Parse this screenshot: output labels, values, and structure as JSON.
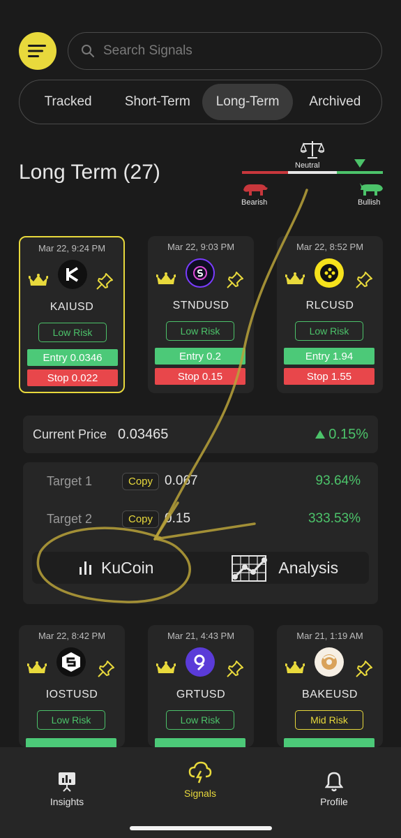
{
  "search": {
    "placeholder": "Search Signals"
  },
  "tabs": [
    {
      "label": "Tracked",
      "active": false
    },
    {
      "label": "Short-Term",
      "active": false
    },
    {
      "label": "Long-Term",
      "active": true
    },
    {
      "label": "Archived",
      "active": false
    }
  ],
  "page_title": "Long Term (27)",
  "sentiment": {
    "neutral_label": "Neutral",
    "bearish_label": "Bearish",
    "bullish_label": "Bullish"
  },
  "cards": [
    {
      "date": "Mar 22, 9:24 PM",
      "symbol": "KAIUSD",
      "risk": "Low Risk",
      "entry": "Entry 0.0346",
      "stop": "Stop 0.022",
      "logo": "kai-logo"
    },
    {
      "date": "Mar 22, 9:03 PM",
      "symbol": "STNDUSD",
      "risk": "Low Risk",
      "entry": "Entry 0.2",
      "stop": "Stop 0.15",
      "logo": "stnd-logo"
    },
    {
      "date": "Mar 22, 8:52 PM",
      "symbol": "RLCUSD",
      "risk": "Low Risk",
      "entry": "Entry 1.94",
      "stop": "Stop 1.55",
      "logo": "rlc-logo"
    },
    {
      "date": "Mar 22, 8:42 PM",
      "symbol": "IOSTUSD",
      "risk": "Low Risk",
      "logo": "iost-logo"
    },
    {
      "date": "Mar 21, 4:43 PM",
      "symbol": "GRTUSD",
      "risk": "Low Risk",
      "logo": "grt-logo"
    },
    {
      "date": "Mar 21, 1:19 AM",
      "symbol": "BAKEUSD",
      "risk": "Mid Risk",
      "logo": "bake-logo"
    }
  ],
  "details": {
    "current_price_label": "Current Price",
    "current_price": "0.03465",
    "change": "0.15%",
    "targets": [
      {
        "label": "Target 1",
        "copy": "Copy",
        "value": "0.067",
        "percent": "93.64%"
      },
      {
        "label": "Target 2",
        "copy": "Copy",
        "value": "0.15",
        "percent": "333.53%"
      }
    ],
    "kucoin_label": "KuCoin",
    "analysis_label": "Analysis"
  },
  "bottom_nav": [
    {
      "label": "Insights",
      "active": false
    },
    {
      "label": "Signals",
      "active": true
    },
    {
      "label": "Profile",
      "active": false
    }
  ],
  "colors": {
    "accent": "#e8d93c",
    "green": "#4cc36a",
    "red": "#e8474b",
    "background": "#1b1b1b"
  }
}
